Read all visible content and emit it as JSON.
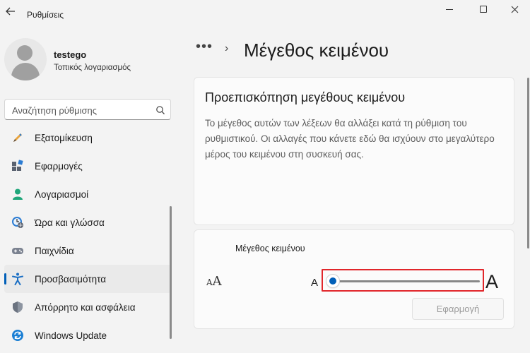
{
  "window": {
    "title": "Ρυθμίσεις",
    "back_icon": "arrow-left-icon",
    "controls": [
      "minimize-icon",
      "maximize-icon",
      "close-icon"
    ]
  },
  "user": {
    "name": "testego",
    "account_type": "Τοπικός λογαριασμός"
  },
  "search": {
    "placeholder": "Αναζήτηση ρύθμισης",
    "icon": "search-icon"
  },
  "sidebar": {
    "items": [
      {
        "label": "Εξατομίκευση",
        "icon": "personalization-icon"
      },
      {
        "label": "Εφαρμογές",
        "icon": "apps-icon"
      },
      {
        "label": "Λογαριασμοί",
        "icon": "accounts-icon"
      },
      {
        "label": "Ώρα και γλώσσα",
        "icon": "time-language-icon"
      },
      {
        "label": "Παιχνίδια",
        "icon": "gaming-icon"
      },
      {
        "label": "Προσβασιμότητα",
        "icon": "accessibility-icon",
        "active": true
      },
      {
        "label": "Απόρρητο και ασφάλεια",
        "icon": "privacy-security-icon"
      },
      {
        "label": "Windows Update",
        "icon": "windows-update-icon"
      }
    ]
  },
  "breadcrumb": {
    "more": "•••",
    "separator": "›",
    "title": "Μέγεθος κειμένου"
  },
  "preview": {
    "title": "Προεπισκόπηση μεγέθους κειμένου",
    "body": "Το μέγεθος αυτών των λέξεων θα αλλάξει κατά τη ρύθμιση του ρυθμιστικού. Οι αλλαγές που κάνετε εδώ θα ισχύουν στο μεγαλύτερο μέρος του κειμένου στη συσκευή σας."
  },
  "text_size": {
    "label": "Μέγεθος κειμένου",
    "icon_small": "A",
    "icon_large": "A",
    "min_label": "A",
    "max_label": "A",
    "value_percent": 0,
    "apply_label": "Εφαρμογή"
  },
  "colors": {
    "accent": "#005fb8",
    "highlight": "#e1262b",
    "background": "#f3f3f3"
  }
}
